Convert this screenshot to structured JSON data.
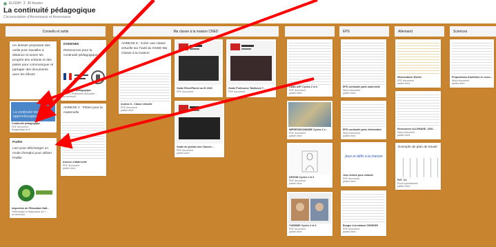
{
  "header": {
    "meta_author": "ELISSH",
    "meta_counter": "3",
    "meta_time": "30 heures",
    "title": "La continuité pédagogique",
    "subtitle": "Circonscription d'Annemasse et Annemasse"
  },
  "columns": [
    {
      "label": "Conseils et outils"
    },
    {
      "label": "Ma classe à la maison CNED"
    },
    {
      "label": ""
    },
    {
      "label": "EPS"
    },
    {
      "label": "Allemand"
    },
    {
      "label": "Sciences"
    }
  ],
  "cards": {
    "dossier": "Un dossier proposant des outils pour travailler à distance et suivre les progrès des enfants et des pistes pour communiquer et partager des documents avec les élèves",
    "ressources_head": "DSDEN65",
    "ressources_body": "Ressources pour la continuité pédagogique",
    "ressources_lbl1": "Continuité pédagogique",
    "ressources_lbl2": "Lumni | Plateforme éducative ...",
    "ressources_lbl3": "ac-annecy.fr",
    "continuite_thumb": "La continuité des apprentissages",
    "continuite_lbl1": "Continuité pédagogique",
    "continuite_lbl2": "PDF document",
    "continuite_lbl3": "blogpedago.ac.fr",
    "annexe4_text": "ANNEXE 4 : Pistes pour la maternelle",
    "annexe4_lbl1": "Annexe 4 Maternelle",
    "annexe4_lbl2": "PDF document",
    "annexe4_lbl3": "padlet drive",
    "padlet_head": "Padlet",
    "padlet_body": "Lien pour télécharger un mode d'emploi pour utiliser Padlet",
    "padlet_lbl1": "Inspection de l'Éducation Nati...",
    "padlet_lbl2": "Télécharger le diaporama sur l'...",
    "padlet_lbl3": "ac-annecy.fr",
    "annexe8_text": "ANNEXE 8 : Créer une classe virtuelle sur l'outil du CNED Ma Classe à la maison",
    "annexe8_lbl1": "Annexe 8 - Classe virtuelle",
    "annexe8_lbl2": "PDF document",
    "annexe8_lbl3": "padlet drive",
    "cned_guide1_lbl1": "Guide Élève/Parent ou ID 2020",
    "cned_guide1_lbl2": "PDF document",
    "cned_guide2_lbl1": "Guide Professeur 'Mallisses T...",
    "cned_guide2_lbl2": "PDF document",
    "cned_guide3_lbl1": "Guide de gestion des Classes ...",
    "cned_guide3_lbl2": "PDF document",
    "cned_guide3_lbl3": "padlet drive",
    "landart_lbl1": "LAND ART Cycles 2 et 3",
    "landart_lbl2": "PDF document",
    "landart_lbl3": "padlet drive",
    "impression_lbl1": "IMPRESSIONNISME Cycles 2 e...",
    "impression_lbl2": "PDF document",
    "impression_lbl3": "padlet drive",
    "dessin_lbl1": "DESSIN Cycles 2 et 3",
    "dessin_lbl2": "PDF document",
    "dessin_lbl3": "padlet drive",
    "cubisme_lbl1": "CUBISME Cycles 2 et 3",
    "cubisme_lbl2": "PDF document",
    "cubisme_lbl3": "padlet drive",
    "eps1_lbl1": "EPS continuité parle maternelle",
    "eps1_lbl2": "Word document",
    "eps1_lbl3": "padlet drive",
    "eps2_lbl1": "EPS continuité parle élémentaire",
    "eps2_lbl2": "Word document",
    "eps2_lbl3": "padlet drive",
    "eps3_thumb": "Jeux et défis à la maison",
    "eps3_lbl1": "Jeux entiers pour enfants",
    "eps3_lbl2": "PDF document",
    "eps3_lbl3": "padlet drive",
    "eps4_lbl1": "Bouger à la maison OSDEN65",
    "eps4_lbl2": "PDF document",
    "eps4_lbl3": "padlet drive",
    "all1_lbl1": "Wochenbuch Woche",
    "all1_lbl2": "PDF document",
    "all1_lbl3": "padlet drive",
    "all2_lbl1": "Ressources ALLEMAND_1920...",
    "all2_lbl2": "Word document",
    "all2_lbl3": "padlet drive",
    "all3_head": "Exemple de plan de travail",
    "all3_lbl1": "PdT_C3",
    "all3_lbl2": "Excel spreadsheet",
    "all3_lbl3": "padlet drive",
    "sci_lbl1": "Propositions d'activités en scien...",
    "sci_lbl2": "Word document",
    "sci_lbl3": "padlet drive"
  },
  "colors": {
    "background": "#c8842f",
    "arrow": "#ff0000"
  },
  "icons": [
    "red-arrow-icon"
  ]
}
